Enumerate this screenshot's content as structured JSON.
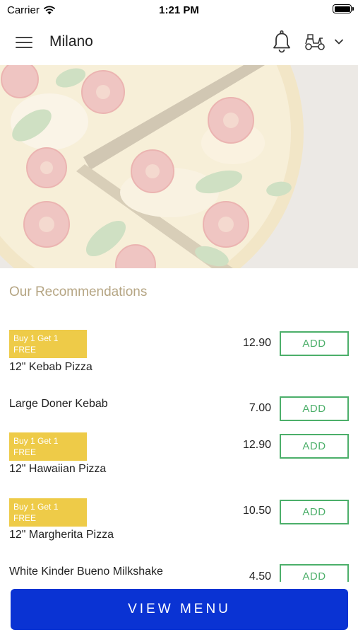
{
  "status": {
    "carrier": "Carrier",
    "time": "1:21 PM"
  },
  "header": {
    "title": "Milano"
  },
  "section": {
    "title": "Our Recommendations"
  },
  "items": [
    {
      "badge": "Buy 1 Get 1 FREE",
      "name": "12\" Kebab Pizza",
      "price": "12.90",
      "add_label": "ADD"
    },
    {
      "badge": "",
      "name": "Large Doner Kebab",
      "price": "7.00",
      "add_label": "ADD"
    },
    {
      "badge": "Buy 1 Get 1 FREE",
      "name": "12\" Hawaiian Pizza",
      "price": "12.90",
      "add_label": "ADD"
    },
    {
      "badge": "Buy 1 Get 1 FREE",
      "name": "12\" Margherita Pizza",
      "price": "10.50",
      "add_label": "ADD"
    },
    {
      "badge": "",
      "name": "White Kinder Bueno Milkshake",
      "price": "4.50",
      "add_label": "ADD"
    }
  ],
  "footer": {
    "view_menu_label": "VIEW MENU"
  },
  "colors": {
    "primary_button": "#0a33d3",
    "add_button": "#4caf6a",
    "badge": "#eecb48",
    "section_title": "#b5a583"
  },
  "icons": [
    "menu-icon",
    "bell-icon",
    "delivery-scooter-icon",
    "chevron-down-icon",
    "wifi-icon",
    "battery-icon"
  ]
}
